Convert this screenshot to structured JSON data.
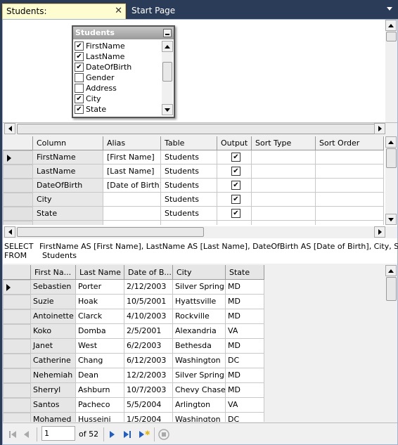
{
  "tabs": [
    {
      "label": "Students: Query(central.rosh)",
      "active": true
    },
    {
      "label": "Start Page",
      "active": false
    }
  ],
  "diagram": {
    "table_name": "Students",
    "columns": [
      {
        "name": "FirstName",
        "checked": true
      },
      {
        "name": "LastName",
        "checked": true
      },
      {
        "name": "DateOfBirth",
        "checked": true
      },
      {
        "name": "Gender",
        "checked": false
      },
      {
        "name": "Address",
        "checked": false
      },
      {
        "name": "City",
        "checked": true
      },
      {
        "name": "State",
        "checked": true
      }
    ]
  },
  "criteria": {
    "headers": [
      "Column",
      "Alias",
      "Table",
      "Output",
      "Sort Type",
      "Sort Order"
    ],
    "rows": [
      {
        "column": "FirstName",
        "alias": "[First Name]",
        "table": "Students",
        "output": true
      },
      {
        "column": "LastName",
        "alias": "[Last Name]",
        "table": "Students",
        "output": true
      },
      {
        "column": "DateOfBirth",
        "alias": "[Date of Birth]",
        "table": "Students",
        "output": true
      },
      {
        "column": "City",
        "alias": "",
        "table": "Students",
        "output": true
      },
      {
        "column": "State",
        "alias": "",
        "table": "Students",
        "output": true
      }
    ]
  },
  "sql": {
    "select_kw": "SELECT",
    "select_text": "FirstName AS [First Name], LastName AS [Last Name], DateOfBirth AS [Date of Birth], City, State",
    "from_kw": "FROM",
    "from_text": "Students"
  },
  "results": {
    "headers": [
      "First Na...",
      "Last Name",
      "Date of B...",
      "City",
      "State"
    ],
    "rows": [
      [
        "Sebastien",
        "Porter",
        "2/12/2003",
        "Silver Spring",
        "MD"
      ],
      [
        "Suzie",
        "Hoak",
        "10/5/2001",
        "Hyattsville",
        "MD"
      ],
      [
        "Antoinette",
        "Clarck",
        "4/10/2003",
        "Rockville",
        "MD"
      ],
      [
        "Koko",
        "Domba",
        "2/5/2001",
        "Alexandria",
        "VA"
      ],
      [
        "Janet",
        "West",
        "6/2/2003",
        "Bethesda",
        "MD"
      ],
      [
        "Catherine",
        "Chang",
        "6/12/2003",
        "Washington",
        "DC"
      ],
      [
        "Nehemiah",
        "Dean",
        "12/2/2003",
        "Silver Spring",
        "MD"
      ],
      [
        "Sherryl",
        "Ashburn",
        "10/7/2003",
        "Chevy Chase",
        "MD"
      ],
      [
        "Santos",
        "Pacheco",
        "5/5/2004",
        "Arlington",
        "VA"
      ],
      [
        "Mohamed",
        "Husseini",
        "1/5/2004",
        "Washington",
        "DC"
      ]
    ]
  },
  "navigator": {
    "current_page": "1",
    "of_text": "of 52"
  },
  "colors": {
    "active_tab_bg": "#fdfdd0",
    "frame_bg": "#2b3c59",
    "nav_icon_blue": "#1f5ec9"
  }
}
